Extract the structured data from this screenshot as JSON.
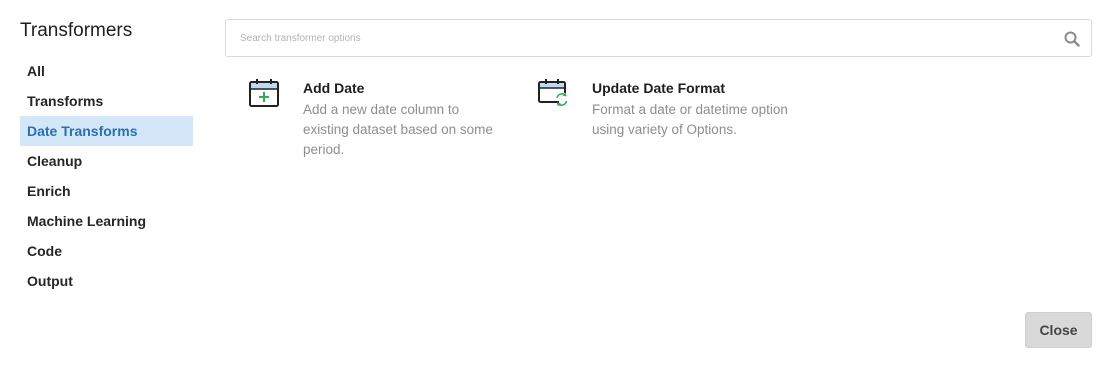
{
  "sidebar": {
    "title": "Transformers",
    "items": [
      {
        "label": "All",
        "active": false
      },
      {
        "label": "Transforms",
        "active": false
      },
      {
        "label": "Date Transforms",
        "active": true
      },
      {
        "label": "Cleanup",
        "active": false
      },
      {
        "label": "Enrich",
        "active": false
      },
      {
        "label": "Machine Learning",
        "active": false
      },
      {
        "label": "Code",
        "active": false
      },
      {
        "label": "Output",
        "active": false
      }
    ]
  },
  "search": {
    "placeholder": "Search transformer options",
    "value": "",
    "icon": "search-icon"
  },
  "cards": [
    {
      "title": "Add Date",
      "description_lines": [
        "Add a new date column to",
        "existing dataset based on some",
        "period."
      ],
      "icon": "calendar-add-icon"
    },
    {
      "title": "Update Date Format",
      "description_lines": [
        "Format a date or datetime option",
        "using variety of Options."
      ],
      "icon": "calendar-refresh-icon"
    }
  ],
  "footer": {
    "close_label": "Close"
  },
  "colors": {
    "active_bg": "#d3e7f9",
    "active_text": "#2a6fb0",
    "icon_accent": "#2fae5a",
    "calendar_header": "#bcdaf2"
  }
}
